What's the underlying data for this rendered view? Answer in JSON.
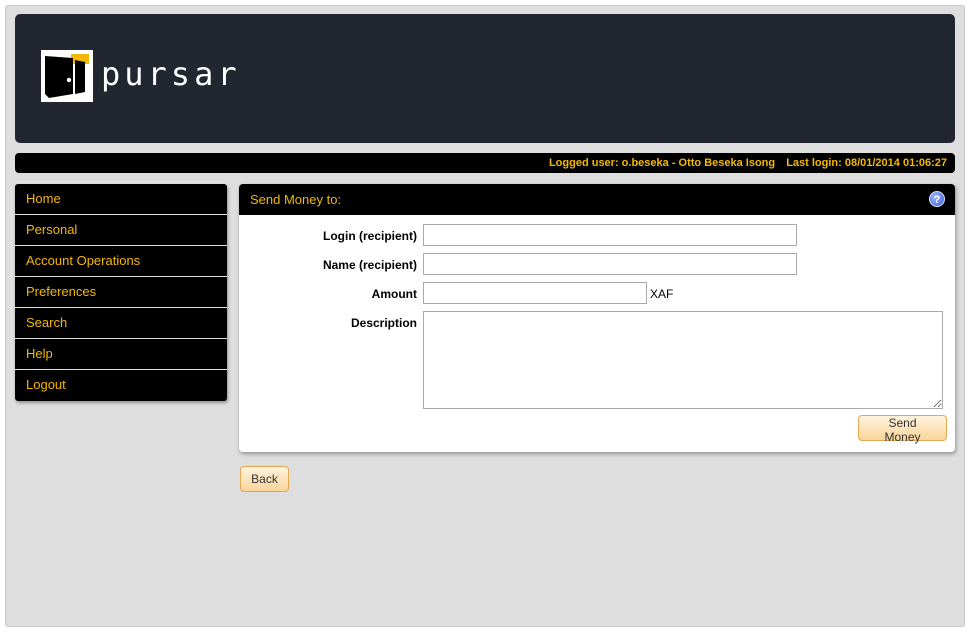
{
  "brand": {
    "name": "pursar"
  },
  "status": {
    "logged_user": "Logged user: o.beseka - Otto Beseka Isong",
    "last_login": "Last login: 08/01/2014 01:06:27"
  },
  "menu": {
    "items": [
      {
        "label": "Home"
      },
      {
        "label": "Personal"
      },
      {
        "label": "Account Operations"
      },
      {
        "label": "Preferences"
      },
      {
        "label": "Search"
      },
      {
        "label": "Help"
      },
      {
        "label": "Logout"
      }
    ]
  },
  "form": {
    "title": "Send Money to:",
    "help_icon_text": "?",
    "login_label": "Login (recipient)",
    "login_value": "",
    "name_label": "Name (recipient)",
    "name_value": "",
    "amount_label": "Amount",
    "amount_value": "",
    "currency": "XAF",
    "description_label": "Description",
    "description_value": "",
    "submit_label": "Send Money"
  },
  "back_label": "Back",
  "colors": {
    "accent": "#f5b800",
    "header_bg": "#222630",
    "menu_bg": "#000000",
    "page_bg": "#dedede",
    "button_border": "#e0a850"
  },
  "icons": {
    "logo": "wallet-door-logo-icon",
    "help": "help-question-icon"
  }
}
